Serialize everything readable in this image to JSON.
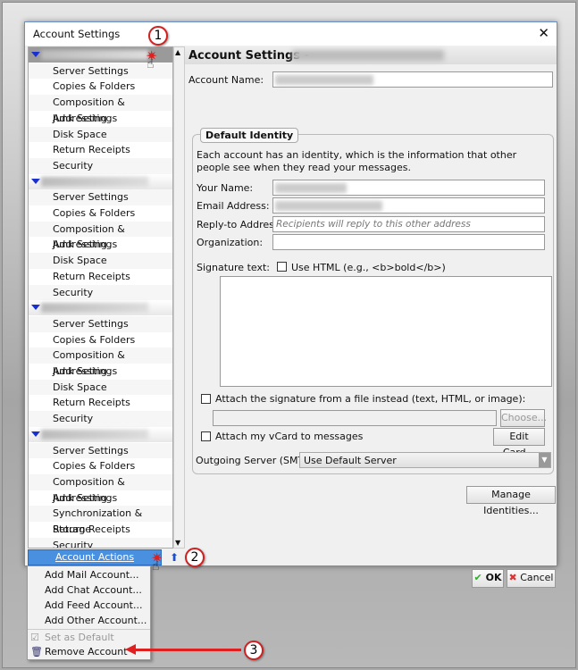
{
  "window": {
    "title": "Account Settings",
    "close_icon": "close-icon"
  },
  "tree": {
    "accounts": [
      {
        "items": [
          "Server Settings",
          "Copies & Folders",
          "Composition & Addressing",
          "Junk Settings",
          "Disk Space",
          "Return Receipts",
          "Security"
        ],
        "selected": true
      },
      {
        "items": [
          "Server Settings",
          "Copies & Folders",
          "Composition & Addressing",
          "Junk Settings",
          "Disk Space",
          "Return Receipts",
          "Security"
        ]
      },
      {
        "items": [
          "Server Settings",
          "Copies & Folders",
          "Composition & Addressing",
          "Junk Settings",
          "Disk Space",
          "Return Receipts",
          "Security"
        ]
      },
      {
        "items": [
          "Server Settings",
          "Copies & Folders",
          "Composition & Addressing",
          "Junk Settings",
          "Synchronization & Storage",
          "Return Receipts",
          "Security"
        ]
      }
    ]
  },
  "account_actions": {
    "label": "Account Actions",
    "menu": [
      {
        "label": "Add Mail Account...",
        "enabled": true
      },
      {
        "label": "Add Chat Account...",
        "enabled": true
      },
      {
        "label": "Add Feed Account...",
        "enabled": true
      },
      {
        "label": "Add Other Account...",
        "enabled": true
      },
      {
        "label": "Set as Default",
        "enabled": false,
        "icon": "checkmark-icon"
      },
      {
        "label": "Remove Account",
        "enabled": true,
        "icon": "trash-icon"
      }
    ]
  },
  "main": {
    "header": "Account Settings -",
    "account_name_label": "Account Name:",
    "identity": {
      "legend": "Default Identity",
      "description": "Each account has an identity, which is the information that other people see when they read your messages.",
      "your_name_label": "Your Name:",
      "email_label": "Email Address:",
      "reply_to_label": "Reply-to Address:",
      "reply_to_placeholder": "Recipients will reply to this other address",
      "organization_label": "Organization:",
      "signature_label": "Signature text:",
      "use_html_label": "Use HTML (e.g., <b>bold</b>)",
      "attach_sig_label": "Attach the signature from a file instead (text, HTML, or image):",
      "choose_button": "Choose...",
      "vcard_label": "Attach my vCard to messages",
      "edit_card_button": "Edit Card...",
      "smtp_label": "Outgoing Server (SMTP):",
      "smtp_value": "Use Default Server"
    },
    "manage_identities_button": "Manage Identities...",
    "ok_button": "OK",
    "cancel_button": "Cancel"
  },
  "annotations": [
    "1",
    "2",
    "3"
  ],
  "colors": {
    "accent": "#4a90e0",
    "annotation": "#e02020",
    "tree_toggle": "#1a2fd0"
  }
}
